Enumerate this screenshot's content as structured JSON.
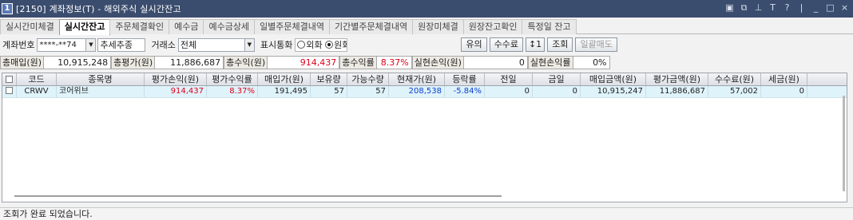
{
  "window": {
    "number": "1",
    "title": "[2150] 계좌정보(T) - 해외주식 실시간잔고",
    "controls": [
      "▣",
      "⧉",
      "⊥",
      "T",
      "?",
      "|",
      "_",
      "□",
      "×"
    ]
  },
  "tabs": [
    "실시간미체결",
    "실시간잔고",
    "주문체결확인",
    "예수금",
    "예수금상세",
    "일별주문체결내역",
    "기간별주문체결내역",
    "원장미체결",
    "원장잔고확인",
    "특정일 잔고"
  ],
  "active_tab": 1,
  "controls": {
    "account_label": "계좌번호",
    "account_value": "****-**74",
    "account_dropdown": "▼",
    "account_alias": "추세추종",
    "exchange_label": "거래소",
    "exchange_value": "전체",
    "exchange_dropdown": "▼",
    "currency_label": "표시통화",
    "currency_options": [
      "외화",
      "원화"
    ],
    "currency_selected": "원화",
    "buttons": {
      "caution": "유의",
      "fee": "수수료",
      "sort": "↕1",
      "query": "조회",
      "bulk_sell": "일괄매도"
    }
  },
  "summary": {
    "total_buy_label": "총매입(원)",
    "total_buy": "10,915,248",
    "total_eval_label": "총평가(원)",
    "total_eval": "11,886,687",
    "total_profit_label": "총수익(원)",
    "total_profit": "914,437",
    "total_return_label": "총수익률",
    "total_return": "8.37%",
    "realized_profit_label": "실현손익(원)",
    "realized_profit": "0",
    "realized_return_label": "실현손익률",
    "realized_return": "0%"
  },
  "table": {
    "headers": [
      "",
      "코드",
      "종목명",
      "평가손익(원)",
      "평가수익률",
      "매입가(원)",
      "보유량",
      "가능수량",
      "현재가(원)",
      "등락률",
      "전일",
      "금일",
      "매입금액(원)",
      "평가금액(원)",
      "수수료(원)",
      "세금(원)"
    ],
    "rows": [
      {
        "code": "CRWV",
        "name": "코어위브",
        "eval_pl": "914,437",
        "eval_return": "8.37%",
        "buy_price": "191,495",
        "holding": "57",
        "available": "57",
        "current_price": "208,538",
        "change_rate": "-5.84%",
        "prev_day": "0",
        "today": "0",
        "buy_amount": "10,915,247",
        "eval_amount": "11,886,687",
        "fee": "57,002",
        "tax": "0"
      }
    ]
  },
  "status": "조회가 완료 되었습니다.",
  "colors": {
    "titlebar": "#3b4d6e",
    "profit_red": "#e0001a",
    "loss_blue": "#0a3fd0",
    "row_highlight": "#dff3fb"
  }
}
